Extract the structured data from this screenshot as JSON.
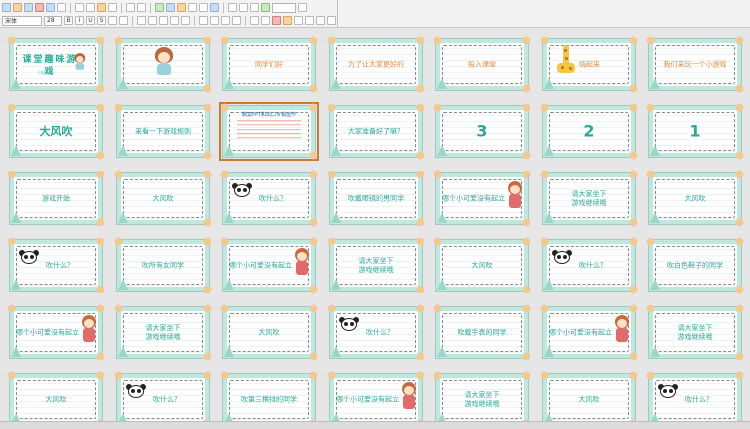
{
  "toolbar": {
    "font_name": "宋体",
    "font_size": "28",
    "zoom": "",
    "bold": "B",
    "italic": "I",
    "underline": "U",
    "strike": "S"
  },
  "slides": [
    {
      "text": "课堂趣味游戏",
      "sub": "（大风吹）",
      "variant": "title",
      "art": "girl"
    },
    {
      "text": "",
      "variant": "plain",
      "art": "girl"
    },
    {
      "text": "同学们好",
      "variant": "orange"
    },
    {
      "text": "为了让大家更好的",
      "variant": "orange"
    },
    {
      "text": "投入课堂",
      "variant": "orange"
    },
    {
      "text": "嗨起来",
      "variant": "orange-right",
      "art": "giraffe"
    },
    {
      "text": "我们来玩一个小游戏",
      "variant": "orange"
    },
    {
      "text": "大风吹",
      "variant": "big"
    },
    {
      "text": "来看一下游戏规则",
      "variant": "plain"
    },
    {
      "text": "",
      "variant": "note",
      "note_title": "教案PPT和出口专销运作",
      "selected": true
    },
    {
      "text": "大家准备好了嘛？",
      "variant": "plain"
    },
    {
      "text": "3",
      "variant": "huge"
    },
    {
      "text": "2",
      "variant": "huge"
    },
    {
      "text": "1",
      "variant": "huge"
    },
    {
      "text": "游戏开始",
      "variant": "plain"
    },
    {
      "text": "大风吹",
      "variant": "plain"
    },
    {
      "text": "吹什么？",
      "variant": "right",
      "art": "panda"
    },
    {
      "text": "吹戴眼镜的男同学",
      "variant": "plain"
    },
    {
      "text": "哪个小可爱没有起立",
      "variant": "left",
      "art": "peek"
    },
    {
      "text": "请大家坐下\n游戏继续哦",
      "variant": "plain"
    },
    {
      "text": "大风吹",
      "variant": "plain"
    },
    {
      "text": "吹什么？",
      "variant": "right",
      "art": "panda"
    },
    {
      "text": "吹所有女同学",
      "variant": "plain"
    },
    {
      "text": "哪个小可爱没有起立",
      "variant": "left",
      "art": "peek"
    },
    {
      "text": "请大家坐下\n游戏继续哦",
      "variant": "plain"
    },
    {
      "text": "大风吹",
      "variant": "plain"
    },
    {
      "text": "吹什么？",
      "variant": "right",
      "art": "panda"
    },
    {
      "text": "吹白色鞋子的同学",
      "variant": "plain"
    },
    {
      "text": "哪个小可爱没有起立",
      "variant": "left",
      "art": "peek"
    },
    {
      "text": "请大家坐下\n游戏继续哦",
      "variant": "plain"
    },
    {
      "text": "大风吹",
      "variant": "plain"
    },
    {
      "text": "吹什么？",
      "variant": "right",
      "art": "panda"
    },
    {
      "text": "吹戴手表的同学",
      "variant": "plain"
    },
    {
      "text": "哪个小可爱没有起立",
      "variant": "left",
      "art": "peek"
    },
    {
      "text": "请大家坐下\n游戏继续哦",
      "variant": "plain"
    },
    {
      "text": "大风吹",
      "variant": "plain"
    },
    {
      "text": "吹什么？",
      "variant": "right",
      "art": "panda"
    },
    {
      "text": "吹第三横排的同学",
      "variant": "plain"
    },
    {
      "text": "哪个小可爱没有起立",
      "variant": "left",
      "art": "peek"
    },
    {
      "text": "请大家坐下\n游戏继续哦",
      "variant": "plain"
    },
    {
      "text": "大风吹",
      "variant": "plain"
    },
    {
      "text": "吹什么？",
      "variant": "right",
      "art": "panda"
    }
  ],
  "colors": {
    "slide_bg": "#bfe8df",
    "teal_text": "#2aaa96",
    "orange_text": "#ec8a3a",
    "selection": "#c07a3a"
  }
}
